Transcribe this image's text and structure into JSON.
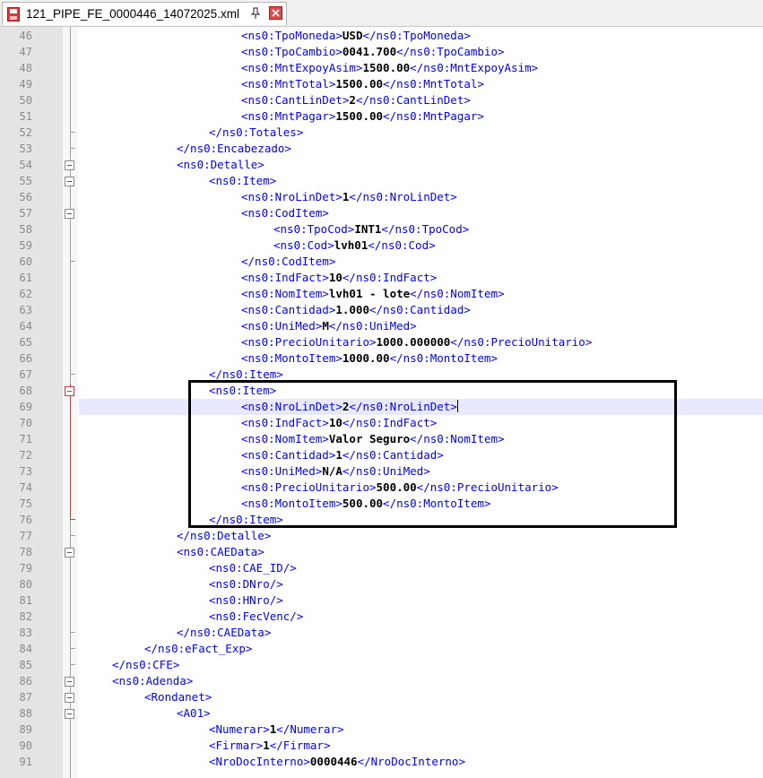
{
  "tab": {
    "title": "121_PIPE_FE_0000446_14072025.xml"
  },
  "lines": [
    {
      "n": "46",
      "indent": 5,
      "open": "<ns0:TpoMoneda>",
      "val": "USD",
      "close": "</ns0:TpoMoneda>"
    },
    {
      "n": "47",
      "indent": 5,
      "open": "<ns0:TpoCambio>",
      "val": "0041.700",
      "close": "</ns0:TpoCambio>"
    },
    {
      "n": "48",
      "indent": 5,
      "open": "<ns0:MntExpoyAsim>",
      "val": "1500.00",
      "close": "</ns0:MntExpoyAsim>"
    },
    {
      "n": "49",
      "indent": 5,
      "open": "<ns0:MntTotal>",
      "val": "1500.00",
      "close": "</ns0:MntTotal>"
    },
    {
      "n": "50",
      "indent": 5,
      "open": "<ns0:CantLinDet>",
      "val": "2",
      "close": "</ns0:CantLinDet>"
    },
    {
      "n": "51",
      "indent": 5,
      "open": "<ns0:MntPagar>",
      "val": "1500.00",
      "close": "</ns0:MntPagar>"
    },
    {
      "n": "52",
      "indent": 4,
      "open": "</ns0:Totales>",
      "val": "",
      "close": ""
    },
    {
      "n": "53",
      "indent": 3,
      "open": "</ns0:Encabezado>",
      "val": "",
      "close": ""
    },
    {
      "n": "54",
      "indent": 3,
      "open": "<ns0:Detalle>",
      "val": "",
      "close": ""
    },
    {
      "n": "55",
      "indent": 4,
      "open": "<ns0:Item>",
      "val": "",
      "close": ""
    },
    {
      "n": "56",
      "indent": 5,
      "open": "<ns0:NroLinDet>",
      "val": "1",
      "close": "</ns0:NroLinDet>"
    },
    {
      "n": "57",
      "indent": 5,
      "open": "<ns0:CodItem>",
      "val": "",
      "close": ""
    },
    {
      "n": "58",
      "indent": 6,
      "open": "<ns0:TpoCod>",
      "val": "INT1",
      "close": "</ns0:TpoCod>"
    },
    {
      "n": "59",
      "indent": 6,
      "open": "<ns0:Cod>",
      "val": "lvh01",
      "close": "</ns0:Cod>"
    },
    {
      "n": "60",
      "indent": 5,
      "open": "</ns0:CodItem>",
      "val": "",
      "close": ""
    },
    {
      "n": "61",
      "indent": 5,
      "open": "<ns0:IndFact>",
      "val": "10",
      "close": "</ns0:IndFact>"
    },
    {
      "n": "62",
      "indent": 5,
      "open": "<ns0:NomItem>",
      "val": "lvh01 - lote",
      "close": "</ns0:NomItem>"
    },
    {
      "n": "63",
      "indent": 5,
      "open": "<ns0:Cantidad>",
      "val": "1.000",
      "close": "</ns0:Cantidad>"
    },
    {
      "n": "64",
      "indent": 5,
      "open": "<ns0:UniMed>",
      "val": "M",
      "close": "</ns0:UniMed>"
    },
    {
      "n": "65",
      "indent": 5,
      "open": "<ns0:PrecioUnitario>",
      "val": "1000.000000",
      "close": "</ns0:PrecioUnitario>"
    },
    {
      "n": "66",
      "indent": 5,
      "open": "<ns0:MontoItem>",
      "val": "1000.00",
      "close": "</ns0:MontoItem>"
    },
    {
      "n": "67",
      "indent": 4,
      "open": "</ns0:Item>",
      "val": "",
      "close": ""
    },
    {
      "n": "68",
      "indent": 4,
      "open": "<ns0:Item>",
      "val": "",
      "close": ""
    },
    {
      "n": "69",
      "indent": 5,
      "open": "<ns0:NroLinDet>",
      "val": "2",
      "close": "</ns0:NroLinDet>"
    },
    {
      "n": "70",
      "indent": 5,
      "open": "<ns0:IndFact>",
      "val": "10",
      "close": "</ns0:IndFact>"
    },
    {
      "n": "71",
      "indent": 5,
      "open": "<ns0:NomItem>",
      "val": "Valor Seguro",
      "close": "</ns0:NomItem>"
    },
    {
      "n": "72",
      "indent": 5,
      "open": "<ns0:Cantidad>",
      "val": "1",
      "close": "</ns0:Cantidad>"
    },
    {
      "n": "73",
      "indent": 5,
      "open": "<ns0:UniMed>",
      "val": "N/A",
      "close": "</ns0:UniMed>"
    },
    {
      "n": "74",
      "indent": 5,
      "open": "<ns0:PrecioUnitario>",
      "val": "500.00",
      "close": "</ns0:PrecioUnitario>"
    },
    {
      "n": "75",
      "indent": 5,
      "open": "<ns0:MontoItem>",
      "val": "500.00",
      "close": "</ns0:MontoItem>"
    },
    {
      "n": "76",
      "indent": 4,
      "open": "</ns0:Item>",
      "val": "",
      "close": ""
    },
    {
      "n": "77",
      "indent": 3,
      "open": "</ns0:Detalle>",
      "val": "",
      "close": ""
    },
    {
      "n": "78",
      "indent": 3,
      "open": "<ns0:CAEData>",
      "val": "",
      "close": ""
    },
    {
      "n": "79",
      "indent": 4,
      "open": "<ns0:CAE_ID/>",
      "val": "",
      "close": ""
    },
    {
      "n": "80",
      "indent": 4,
      "open": "<ns0:DNro/>",
      "val": "",
      "close": ""
    },
    {
      "n": "81",
      "indent": 4,
      "open": "<ns0:HNro/>",
      "val": "",
      "close": ""
    },
    {
      "n": "82",
      "indent": 4,
      "open": "<ns0:FecVenc/>",
      "val": "",
      "close": ""
    },
    {
      "n": "83",
      "indent": 3,
      "open": "</ns0:CAEData>",
      "val": "",
      "close": ""
    },
    {
      "n": "84",
      "indent": 2,
      "open": "</ns0:eFact_Exp>",
      "val": "",
      "close": ""
    },
    {
      "n": "85",
      "indent": 1,
      "open": "</ns0:CFE>",
      "val": "",
      "close": ""
    },
    {
      "n": "86",
      "indent": 1,
      "open": "<ns0:Adenda>",
      "val": "",
      "close": ""
    },
    {
      "n": "87",
      "indent": 2,
      "open": "<Rondanet>",
      "val": "",
      "close": ""
    },
    {
      "n": "88",
      "indent": 3,
      "open": "<A01>",
      "val": "",
      "close": ""
    },
    {
      "n": "89",
      "indent": 4,
      "open": "<Numerar>",
      "val": "1",
      "close": "</Numerar>"
    },
    {
      "n": "90",
      "indent": 4,
      "open": "<Firmar>",
      "val": "1",
      "close": "</Firmar>"
    },
    {
      "n": "91",
      "indent": 4,
      "open": "<NroDocInterno>",
      "val": "0000446",
      "close": "</NroDocInterno>"
    }
  ]
}
